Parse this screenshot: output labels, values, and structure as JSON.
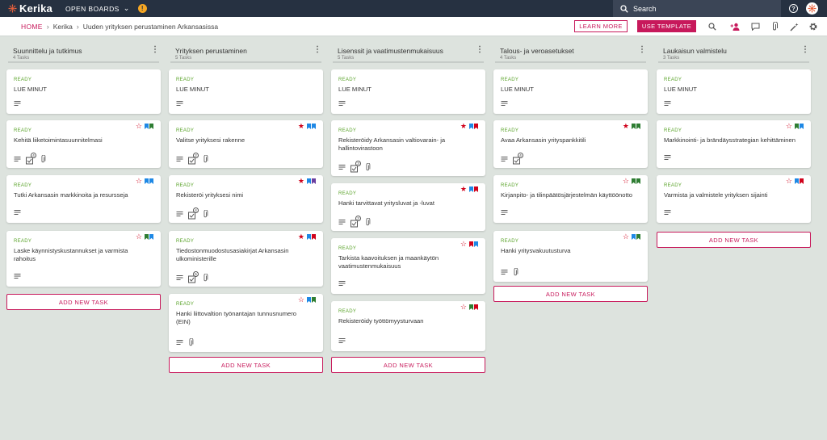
{
  "app": {
    "logo": "Kerika",
    "open_boards": "OPEN BOARDS",
    "notif": "!",
    "search_placeholder": "Search",
    "help": "?"
  },
  "breadcrumb": {
    "home": "HOME",
    "org": "Kerika",
    "board": "Uuden yrityksen perustaminen Arkansasissa"
  },
  "toolbar": {
    "learn_more": "LEARN MORE",
    "use_template": "USE TEMPLATE"
  },
  "colors": {
    "accent": "#c7195b",
    "topbar": "#263141",
    "ready": "#5aa32a",
    "flag_blue": "#1e88e5",
    "flag_green": "#2e7d32",
    "flag_red": "#d0021b",
    "flag_purple": "#6a3fa0"
  },
  "add_task_label": "ADD NEW TASK",
  "columns": [
    {
      "title": "Suunnittelu ja tutkimus",
      "count": "4 Tasks",
      "cards": [
        {
          "status": "READY",
          "title": "LUE MINUT"
        },
        {
          "status": "READY",
          "title": "Kehitä liiketoimintasuunnitelmasi",
          "checklist": "4"
        },
        {
          "status": "READY",
          "title": "Tutki Arkansasin markkinoita ja resursseja"
        },
        {
          "status": "READY",
          "title": "Laske käynnistyskustannukset ja varmista rahoitus"
        }
      ]
    },
    {
      "title": "Yrityksen perustaminen",
      "count": "5 Tasks",
      "cards": [
        {
          "status": "READY",
          "title": "LUE MINUT"
        },
        {
          "status": "READY",
          "title": "Valitse yrityksesi rakenne",
          "checklist": "2"
        },
        {
          "status": "READY",
          "title": "Rekisteröi yrityksesi nimi",
          "checklist": "4"
        },
        {
          "status": "READY",
          "title": "Tiedostonmuodostusasiakirjat Arkansasin ulkoministerille",
          "checklist": "5"
        },
        {
          "status": "READY",
          "title": "Hanki liittovaltion työnantajan tunnusnumero (EIN)"
        }
      ]
    },
    {
      "title": "Lisenssit ja vaatimustenmukaisuus",
      "count": "5 Tasks",
      "cards": [
        {
          "status": "READY",
          "title": "LUE MINUT"
        },
        {
          "status": "READY",
          "title": "Rekisteröidy Arkansasin valtiovarain- ja hallintovirastoon",
          "checklist": "3"
        },
        {
          "status": "READY",
          "title": "Hanki tarvittavat yritysluvat ja -luvat",
          "checklist": "2"
        },
        {
          "status": "READY",
          "title": "Tarkista kaavoituksen ja maankäytön vaatimustenmukaisuus"
        },
        {
          "status": "READY",
          "title": "Rekisteröidy työttömyysturvaan"
        }
      ]
    },
    {
      "title": "Talous- ja veroasetukset",
      "count": "4 Tasks",
      "cards": [
        {
          "status": "READY",
          "title": "LUE MINUT"
        },
        {
          "status": "READY",
          "title": "Avaa Arkansasin yrityspankkitili",
          "checklist": "4"
        },
        {
          "status": "READY",
          "title": "Kirjanpito- ja tilinpäätösjärjestelmän käyttöönotto"
        },
        {
          "status": "READY",
          "title": "Hanki yritysvakuutusturva"
        }
      ]
    },
    {
      "title": "Laukaisun valmistelu",
      "count": "3 Tasks",
      "cards": [
        {
          "status": "READY",
          "title": "LUE MINUT"
        },
        {
          "status": "READY",
          "title": "Markkinointi- ja brändäysstrategian kehittäminen"
        },
        {
          "status": "READY",
          "title": "Varmista ja valmistele yrityksen sijainti"
        }
      ]
    }
  ]
}
